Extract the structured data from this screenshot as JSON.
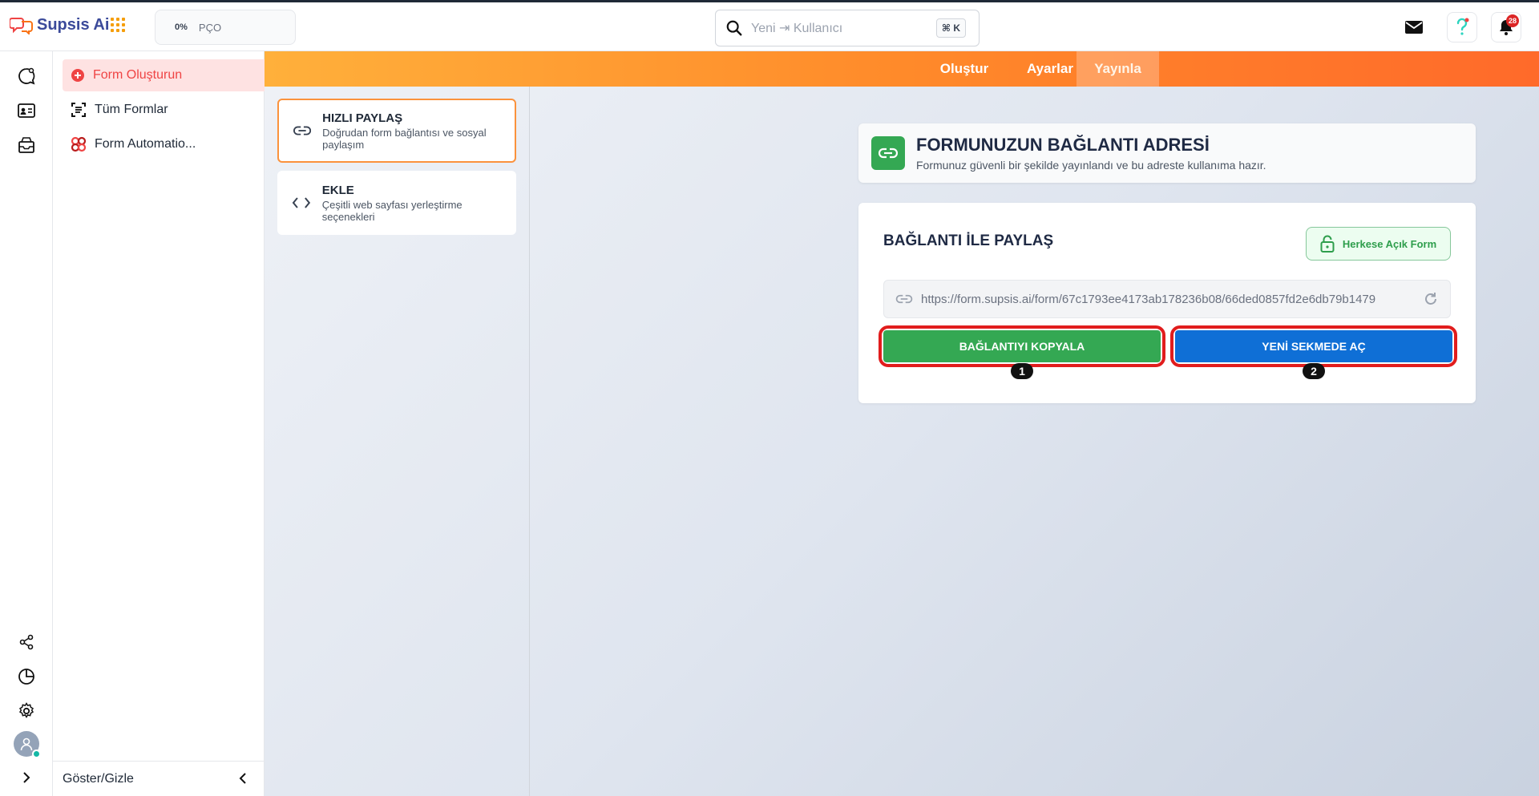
{
  "app": {
    "name": "Supsis Ai",
    "progress": {
      "percent_label": "0%",
      "label": "PÇO"
    },
    "search": {
      "placeholder": "Yeni ⇥ Kullanıcı",
      "shortcut": "⌘ K"
    },
    "notifications_count": "28"
  },
  "sidebar": {
    "items": [
      {
        "label": "Form Oluşturun",
        "icon": "plus-circle-icon",
        "active": true
      },
      {
        "label": "Tüm Formlar",
        "icon": "form-list-icon",
        "active": false
      },
      {
        "label": "Form Automatio...",
        "icon": "automation-icon",
        "active": false
      }
    ],
    "footer_label": "Göster/Gizle"
  },
  "tabs": [
    {
      "label": "Oluştur",
      "active": false
    },
    {
      "label": "Ayarlar",
      "active": false
    },
    {
      "label": "Yayınla",
      "active": true
    }
  ],
  "share_options": [
    {
      "title": "HIZLI PAYLAŞ",
      "desc": "Doğrudan form bağlantısı ve sosyal paylaşım",
      "active": true
    },
    {
      "title": "EKLE",
      "desc": "Çeşitli web sayfası yerleştirme seçenekleri",
      "active": false
    }
  ],
  "url_header": {
    "title": "FORMUNUZUN BAĞLANTI ADRESİ",
    "subtitle": "Formunuz güvenli bir şekilde yayınlandı ve bu adreste kullanıma hazır."
  },
  "share_panel": {
    "title": "BAĞLANTI İLE PAYLAŞ",
    "public_label": "Herkese Açık Form",
    "url": "https://form.supsis.ai/form/67c1793ee4173ab178236b08/66ded0857fd2e6db79b1479",
    "copy_label": "BAĞLANTIYI KOPYALA",
    "open_label": "YENİ SEKMEDE AÇ",
    "markers": [
      "1",
      "2"
    ]
  },
  "colors": {
    "brand": "#3b4a9a",
    "accent_orange": "#ff8a2a",
    "green": "#34a853",
    "blue": "#0f6fd6",
    "highlight_red": "#e11d1d"
  }
}
